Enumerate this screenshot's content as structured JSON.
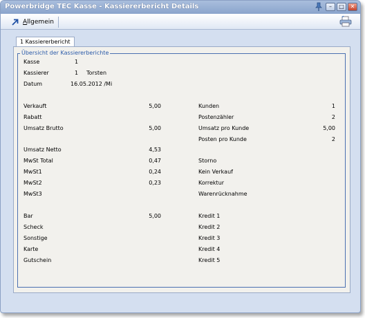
{
  "window": {
    "title": "Powerbridge TEC Kasse - Kassiererbericht Details"
  },
  "toolbar": {
    "allgemein_label": "Allgemein",
    "allgemein_hotkey": "A",
    "allgemein_rest": "llgemein"
  },
  "tab": {
    "label": "1 Kassiererbericht"
  },
  "group": {
    "legend": "Übersicht der Kassiererberichte"
  },
  "header": {
    "kasse_label": "Kasse",
    "kasse_value": "1",
    "kassierer_label": "Kassierer",
    "kassierer_id": "1",
    "kassierer_name": "Torsten",
    "datum_label": "Datum",
    "datum_value": "16.05.2012 /Mi"
  },
  "left_block1": [
    {
      "label": "Verkauft",
      "value": "5,00"
    },
    {
      "label": "Rabatt",
      "value": ""
    },
    {
      "label": "Umsatz Brutto",
      "value": "5,00"
    }
  ],
  "left_block2": [
    {
      "label": "Umsatz Netto",
      "value": "4,53"
    },
    {
      "label": "MwSt Total",
      "value": "0,47"
    },
    {
      "label": "MwSt1",
      "value": "0,24"
    },
    {
      "label": "MwSt2",
      "value": "0,23"
    },
    {
      "label": "MwSt3",
      "value": ""
    }
  ],
  "left_block3": [
    {
      "label": "Bar",
      "value": "5,00"
    },
    {
      "label": "Scheck",
      "value": ""
    },
    {
      "label": "Sonstige",
      "value": ""
    },
    {
      "label": "Karte",
      "value": ""
    },
    {
      "label": "Gutschein",
      "value": ""
    }
  ],
  "right_block1": [
    {
      "label": "Kunden",
      "value": "1"
    },
    {
      "label": "Postenzähler",
      "value": "2"
    },
    {
      "label": "Umsatz pro Kunde",
      "value": "5,00"
    },
    {
      "label": "Posten pro Kunde",
      "value": "2"
    }
  ],
  "right_block2": [
    {
      "label": "Storno",
      "value": ""
    },
    {
      "label": "Kein Verkauf",
      "value": ""
    },
    {
      "label": "Korrektur",
      "value": ""
    },
    {
      "label": "Warenrücknahme",
      "value": ""
    }
  ],
  "right_block3": [
    {
      "label": "Kredit 1",
      "value": ""
    },
    {
      "label": "Kredit 2",
      "value": ""
    },
    {
      "label": "Kredit 3",
      "value": ""
    },
    {
      "label": "Kredit 4",
      "value": ""
    },
    {
      "label": "Kredit 5",
      "value": ""
    }
  ]
}
